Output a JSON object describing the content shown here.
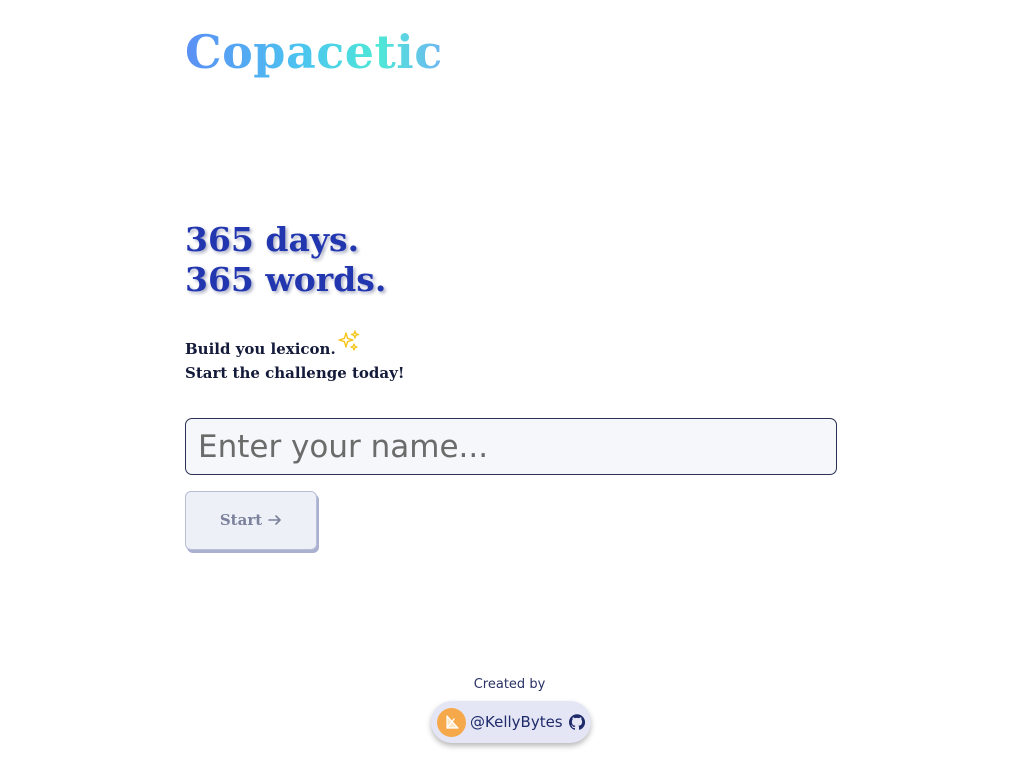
{
  "header": {
    "logo_text": "Copacetic"
  },
  "hero": {
    "line1": "365 days.",
    "line2": "365 words."
  },
  "intro": {
    "line1": "Build you lexicon.",
    "line2": "Start the challenge today!",
    "decoration_icon": "sparkles-icon"
  },
  "form": {
    "name_placeholder": "Enter your name...",
    "name_value": "",
    "start_label": "Start",
    "start_icon": "arrow-right-icon"
  },
  "footer": {
    "created_by_label": "Created by",
    "author_handle": "@KellyBytes",
    "author_icon": "github-icon"
  },
  "colors": {
    "headline": "#2236b0",
    "logo_gradient_start": "#5b8ff5",
    "logo_gradient_end": "#4ee8d6",
    "sparkle": "#f5c518",
    "avatar": "#f6a94a"
  }
}
